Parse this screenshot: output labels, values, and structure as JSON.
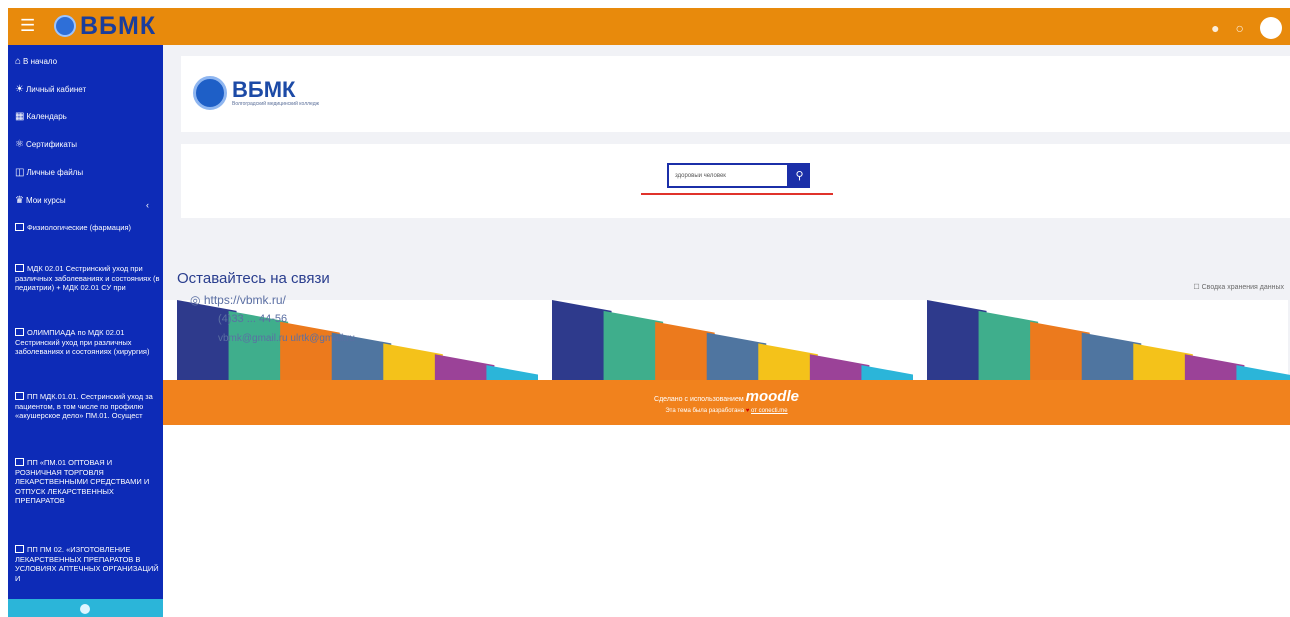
{
  "navbar": {
    "menu_icon": "hamburger-icon",
    "logo_text": "ВБМК",
    "icons": [
      "bell-icon",
      "chat-icon"
    ]
  },
  "sidebar": {
    "items": [
      {
        "label": "В начало",
        "icon": "home-icon"
      },
      {
        "label": "Личный кабинет",
        "icon": "dashboard-icon"
      },
      {
        "label": "Календарь",
        "icon": "calendar-icon"
      },
      {
        "label": "Сертификаты",
        "icon": "certificate-icon"
      },
      {
        "label": "Личные файлы",
        "icon": "file-icon"
      },
      {
        "label": "Мои курсы",
        "icon": "graduation-cap-icon"
      }
    ],
    "courses": [
      "Физиологические (фармация)",
      "МДК 02.01 Сестринский уход при различных заболеваниях и состояниях (в педиатрии) + МДК 02.01 СУ при",
      "ОЛИМПИАДА по МДК 02.01 Сестринский уход при различных заболеваниях и состояниях (хирургия)",
      "ПП МДК.01.01. Сестринский уход за пациентом, в том числе по профилю «акушерское дело» ПМ.01. Осущест",
      "ПП «ПМ.01 ОПТОВАЯ И РОЗНИЧНАЯ ТОРГОВЛЯ ЛЕКАРСТВЕННЫМИ СРЕДСТВАМИ И ОТПУСК ЛЕКАРСТВЕННЫХ ПРЕПАРАТОВ",
      "ПП ПМ 02. «ИЗГОТОВЛЕНИЕ ЛЕКАРСТВЕННЫХ ПРЕПАРАТОВ В УСЛОВИЯХ АПТЕЧНЫХ ОРГАНИЗАЦИЙ И"
    ]
  },
  "header": {
    "logo_text": "ВБМК",
    "logo_sub": "Волгоградский медицинский колледж"
  },
  "search": {
    "value": "здоровый человек",
    "button_icon": "search-icon"
  },
  "footer": {
    "contact_title": "Оставайтесь на связи",
    "site_link": "https://vbmk.ru/",
    "phone": "(4)33 ... 44-56",
    "email": "vbmk@gmail.ru   ulrtk@gmail.ru",
    "summary_link": "Сводка хранения данных",
    "made_with": "Сделано с использованием",
    "moodle": "moodle",
    "credit_prefix": "Эта тема была разработана",
    "credit_suffix": "от conecti.me"
  },
  "colors": {
    "navbar": "#e88a0c",
    "sidebar": "#0d2bb7",
    "accent": "#1b2fa8",
    "footer_band": "#f1821d",
    "stripes": [
      "#2e3a8c",
      "#3fae8c",
      "#ec7a1d",
      "#4f75a0",
      "#f4c21a",
      "#9b4298",
      "#2bb5d9"
    ]
  }
}
